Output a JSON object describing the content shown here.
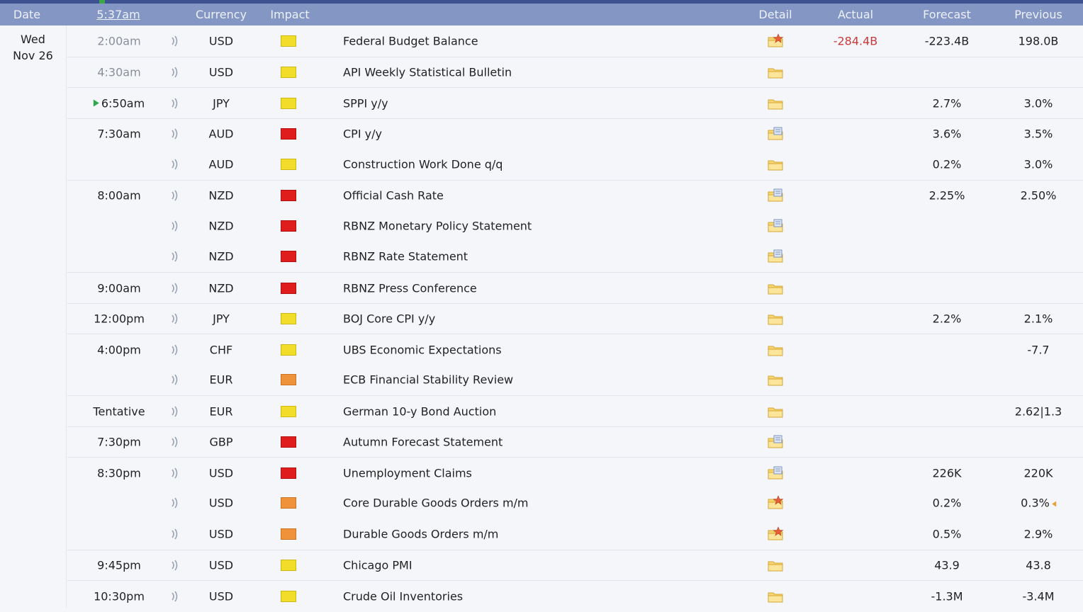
{
  "header": {
    "date": "Date",
    "clock": "5:37am",
    "currency": "Currency",
    "impact": "Impact",
    "detail": "Detail",
    "actual": "Actual",
    "forecast": "Forecast",
    "previous": "Previous"
  },
  "day": {
    "weekday": "Wed",
    "date": "Nov 26"
  },
  "colors": {
    "header_bg": "#8396c4",
    "actual_text": "#c93a3a",
    "impact_high": "#e01d1d",
    "impact_medium": "#f0923a",
    "impact_low": "#f2dd2a"
  },
  "rows": [
    {
      "time": "2:00am",
      "currency": "USD",
      "impact": "yellow",
      "event": "Federal Budget Balance",
      "detail": "folder-star",
      "actual": "-284.4B",
      "forecast": "-223.4B",
      "previous": "198.0B"
    },
    {
      "time": "4:30am",
      "currency": "USD",
      "impact": "yellow",
      "event": "API Weekly Statistical Bulletin",
      "detail": "folder",
      "actual": "",
      "forecast": "",
      "previous": ""
    },
    {
      "time": "6:50am",
      "currency": "JPY",
      "impact": "yellow",
      "event": "SPPI y/y",
      "detail": "folder",
      "actual": "",
      "forecast": "2.7%",
      "previous": "3.0%"
    },
    {
      "time": "7:30am",
      "currency": "AUD",
      "impact": "red",
      "event": "CPI y/y",
      "detail": "folder-doc",
      "actual": "",
      "forecast": "3.6%",
      "previous": "3.5%"
    },
    {
      "time": "",
      "currency": "AUD",
      "impact": "yellow",
      "event": "Construction Work Done q/q",
      "detail": "folder",
      "actual": "",
      "forecast": "0.2%",
      "previous": "3.0%"
    },
    {
      "time": "8:00am",
      "currency": "NZD",
      "impact": "red",
      "event": "Official Cash Rate",
      "detail": "folder-doc",
      "actual": "",
      "forecast": "2.25%",
      "previous": "2.50%"
    },
    {
      "time": "",
      "currency": "NZD",
      "impact": "red",
      "event": "RBNZ Monetary Policy Statement",
      "detail": "folder-doc",
      "actual": "",
      "forecast": "",
      "previous": ""
    },
    {
      "time": "",
      "currency": "NZD",
      "impact": "red",
      "event": "RBNZ Rate Statement",
      "detail": "folder-doc",
      "actual": "",
      "forecast": "",
      "previous": ""
    },
    {
      "time": "9:00am",
      "currency": "NZD",
      "impact": "red",
      "event": "RBNZ Press Conference",
      "detail": "folder",
      "actual": "",
      "forecast": "",
      "previous": ""
    },
    {
      "time": "12:00pm",
      "currency": "JPY",
      "impact": "yellow",
      "event": "BOJ Core CPI y/y",
      "detail": "folder",
      "actual": "",
      "forecast": "2.2%",
      "previous": "2.1%"
    },
    {
      "time": "4:00pm",
      "currency": "CHF",
      "impact": "yellow",
      "event": "UBS Economic Expectations",
      "detail": "folder",
      "actual": "",
      "forecast": "",
      "previous": "-7.7"
    },
    {
      "time": "",
      "currency": "EUR",
      "impact": "orange",
      "event": "ECB Financial Stability Review",
      "detail": "folder",
      "actual": "",
      "forecast": "",
      "previous": ""
    },
    {
      "time": "Tentative",
      "currency": "EUR",
      "impact": "yellow",
      "event": "German 10-y Bond Auction",
      "detail": "folder",
      "actual": "",
      "forecast": "",
      "previous": "2.62|1.3"
    },
    {
      "time": "7:30pm",
      "currency": "GBP",
      "impact": "red",
      "event": "Autumn Forecast Statement",
      "detail": "folder-doc",
      "actual": "",
      "forecast": "",
      "previous": ""
    },
    {
      "time": "8:30pm",
      "currency": "USD",
      "impact": "red",
      "event": "Unemployment Claims",
      "detail": "folder-doc",
      "actual": "",
      "forecast": "226K",
      "previous": "220K"
    },
    {
      "time": "",
      "currency": "USD",
      "impact": "orange",
      "event": "Core Durable Goods Orders m/m",
      "detail": "folder-star",
      "actual": "",
      "forecast": "0.2%",
      "previous": "0.3%",
      "revised": true
    },
    {
      "time": "",
      "currency": "USD",
      "impact": "orange",
      "event": "Durable Goods Orders m/m",
      "detail": "folder-star",
      "actual": "",
      "forecast": "0.5%",
      "previous": "2.9%"
    },
    {
      "time": "9:45pm",
      "currency": "USD",
      "impact": "yellow",
      "event": "Chicago PMI",
      "detail": "folder",
      "actual": "",
      "forecast": "43.9",
      "previous": "43.8"
    },
    {
      "time": "10:30pm",
      "currency": "USD",
      "impact": "yellow",
      "event": "Crude Oil Inventories",
      "detail": "folder",
      "actual": "",
      "forecast": "-1.3M",
      "previous": "-3.4M"
    }
  ]
}
